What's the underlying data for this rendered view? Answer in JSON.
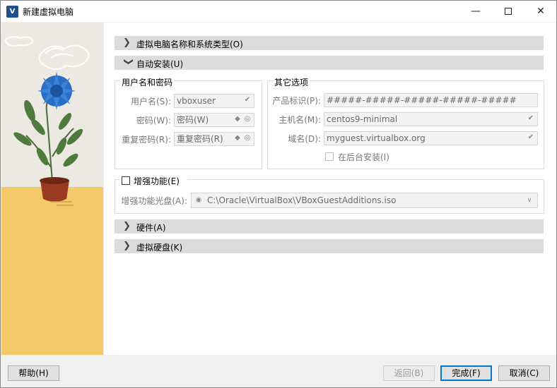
{
  "window": {
    "title": "新建虚拟电脑",
    "app_icon_text": "V",
    "minimize": "—",
    "maximize": "",
    "close": "✕"
  },
  "sections": {
    "name_os": {
      "label": "虚拟电脑名称和系统类型(O)",
      "expanded": false
    },
    "unattended": {
      "label": "自动安装(U)",
      "expanded": true
    },
    "hardware": {
      "label": "硬件(A)",
      "expanded": false
    },
    "harddisk": {
      "label": "虚拟硬盘(K)",
      "expanded": false
    }
  },
  "user_group": {
    "title": "用户名和密码",
    "username_label": "用户名(S):",
    "username_value": "vboxuser",
    "password_label": "密码(W):",
    "password_value": "密码(W)",
    "repeat_label": "重复密码(R):",
    "repeat_value": "重复密码(R)"
  },
  "other_group": {
    "title": "其它选项",
    "product_key_label": "产品标识(P):",
    "product_key_value": "#####-#####-#####-#####-#####",
    "hostname_label": "主机名(M):",
    "hostname_value": "centos9-minimal",
    "domain_label": "域名(D):",
    "domain_value": "myguest.virtualbox.org",
    "background_label": "在后台安装(I)",
    "background_checked": false
  },
  "guest_additions": {
    "checkbox_label": "增强功能(E)",
    "checked": false,
    "iso_label": "增强功能光盘(A):",
    "iso_path": "C:\\Oracle\\VirtualBox\\VBoxGuestAdditions.iso"
  },
  "buttons": {
    "help": "帮助(H)",
    "back": "返回(B)",
    "finish": "完成(F)",
    "cancel": "取消(C)"
  },
  "colors": {
    "accent": "#0078d7",
    "section_header": "#dcdcdc",
    "illustration_table": "#f3c96a",
    "flower": "#2a6fc4",
    "pot": "#9a3a22"
  }
}
